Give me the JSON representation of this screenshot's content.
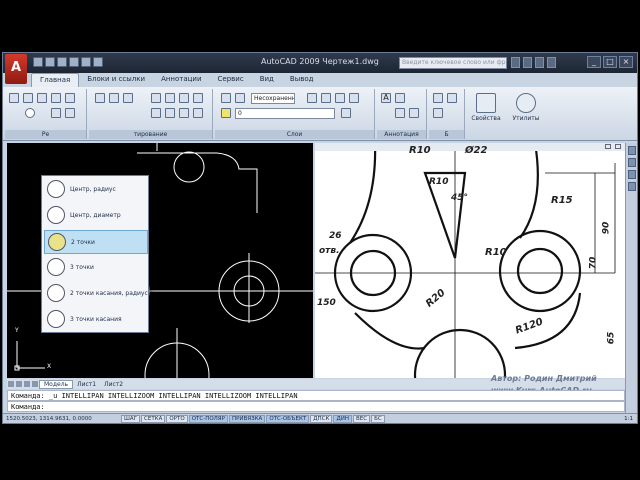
{
  "window": {
    "title": "AutoCAD 2009 Чертеж1.dwg",
    "search_placeholder": "Введите ключевое слово или фразу"
  },
  "ribbon": {
    "tabs": [
      "Главная",
      "Блоки и ссылки",
      "Аннотации",
      "Сервис",
      "Вид",
      "Вывод"
    ],
    "active_tab": "Главная",
    "panel_labels": {
      "draw": "Ре",
      "modify": "тирование",
      "layers": "Слои",
      "annotation": "Аннотация",
      "block": "Б"
    },
    "layer_state": "Несохраненн",
    "layer_current": "0",
    "properties_label": "Свойства",
    "utilities_label": "Утилиты"
  },
  "circle_menu": {
    "items": [
      {
        "label": "Центр, радиус",
        "highlighted": false
      },
      {
        "label": "Центр, диаметр",
        "highlighted": false
      },
      {
        "label": "2 точки",
        "highlighted": true
      },
      {
        "label": "3 точки",
        "highlighted": false
      },
      {
        "label": "2 точки касания, радиус",
        "highlighted": false
      },
      {
        "label": "3 точки касания",
        "highlighted": false
      }
    ]
  },
  "reference_drawing": {
    "dims": [
      "R10",
      "Ø22",
      "R10",
      "45°",
      "R15",
      "90",
      "70",
      "R10",
      "R20",
      "R120",
      "65",
      "26",
      "150"
    ],
    "abbrev": "отв."
  },
  "layout_tabs": [
    "Модель",
    "Лист1",
    "Лист2"
  ],
  "watermark": {
    "author": "Автор: Родин Дмитрий",
    "site": "www.Kurs-AutoCAD.ru"
  },
  "command": {
    "line1": "Команда: _u INTELLIPAN INTELLIZOOM INTELLIPAN INTELLIZOOM INTELLIPAN",
    "line2": "Команда:"
  },
  "status_bar": {
    "coords": "1520.5023, 1314.9631, 0.0000",
    "buttons": [
      {
        "label": "ШАГ",
        "on": false
      },
      {
        "label": "СЕТКА",
        "on": false
      },
      {
        "label": "ОРТО",
        "on": false
      },
      {
        "label": "ОТС-ПОЛЯР",
        "on": true
      },
      {
        "label": "ПРИВЯЗКА",
        "on": true
      },
      {
        "label": "ОТС-ОБЪЕКТ",
        "on": true
      },
      {
        "label": "ДПСК",
        "on": false
      },
      {
        "label": "ДИН",
        "on": true
      },
      {
        "label": "ВЕС",
        "on": false
      },
      {
        "label": "БС",
        "on": false
      }
    ],
    "scale": "1:1"
  },
  "ucs": {
    "x": "X",
    "y": "Y"
  },
  "colors": {
    "accent": "#bfe0f2",
    "ribbon": "#cbd6e4",
    "canvas": "#000000"
  }
}
